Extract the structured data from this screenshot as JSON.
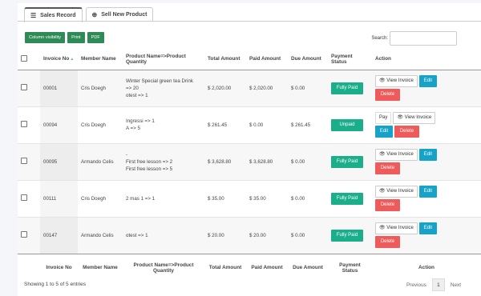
{
  "tabs": [
    {
      "label": "Sales Record",
      "icon": "list-icon"
    },
    {
      "label": "Sell New Product",
      "icon": "plus-circle-icon"
    }
  ],
  "toolbar": {
    "column_visibility": "Column visibility",
    "print": "Print",
    "pdf": "PDF"
  },
  "search": {
    "label": "Search:",
    "value": ""
  },
  "columns": [
    "Invoice No",
    "Member Name",
    "Product Name=>Product Quantity",
    "Total Amount",
    "Paid Amount",
    "Due Amount",
    "Payment Status",
    "Action"
  ],
  "footer_columns": [
    "Invoice No",
    "Member Name",
    "Product Name=>Product Quantity",
    "Total Amount",
    "Paid Amount",
    "Due Amount",
    "Payment Status",
    "Action"
  ],
  "rows": [
    {
      "invoice": "00001",
      "member": "Cris Doegh",
      "products": [
        "Winter Special green tea Drink",
        "=> 20",
        "otest => 1"
      ],
      "total": "$ 2,020.00",
      "paid": "$ 2,020.00",
      "due": "$ 0.00",
      "status": "Fully Paid",
      "status_color": "#1aae8a"
    },
    {
      "invoice": "00094",
      "member": "Cris Doegh",
      "products": [
        "Ingressi => 1",
        "A => 5"
      ],
      "total": "$ 261.45",
      "paid": "$ 0.00",
      "due": "$ 261.45",
      "status": "Unpaid",
      "status_color": "#1aae8a"
    },
    {
      "invoice": "00095",
      "member": "Armando Celis",
      "products": [
        "-",
        "First free lesson => 2",
        "First free lesson => 5"
      ],
      "total": "$ 3,628.80",
      "paid": "$ 3,628.80",
      "due": "$ 0.00",
      "status": "Fully Paid",
      "status_color": "#1aae8a"
    },
    {
      "invoice": "00111",
      "member": "Cris Doegh",
      "products": [
        "2 mas 1 => 1"
      ],
      "total": "$ 35.00",
      "paid": "$ 35.00",
      "due": "$ 0.00",
      "status": "Fully Paid",
      "status_color": "#1aae8a"
    },
    {
      "invoice": "00147",
      "member": "Armando Celis",
      "products": [
        "otest => 1"
      ],
      "total": "$ 20.00",
      "paid": "$ 20.00",
      "due": "$ 0.00",
      "status": "Fully Paid",
      "status_color": "#1aae8a"
    }
  ],
  "actions": {
    "view": "View Invoice",
    "edit": "Edit",
    "delete": "Delete",
    "pay": "Pay"
  },
  "info": "Showing 1 to 5 of 5 entries",
  "pagination": {
    "previous": "Previous",
    "page": "1",
    "next": "Next"
  },
  "colors": {
    "primary_green": "#2e8b57",
    "status_green": "#1aae8a",
    "edit_blue": "#17a2c8",
    "delete_red": "#ef5b5b"
  }
}
